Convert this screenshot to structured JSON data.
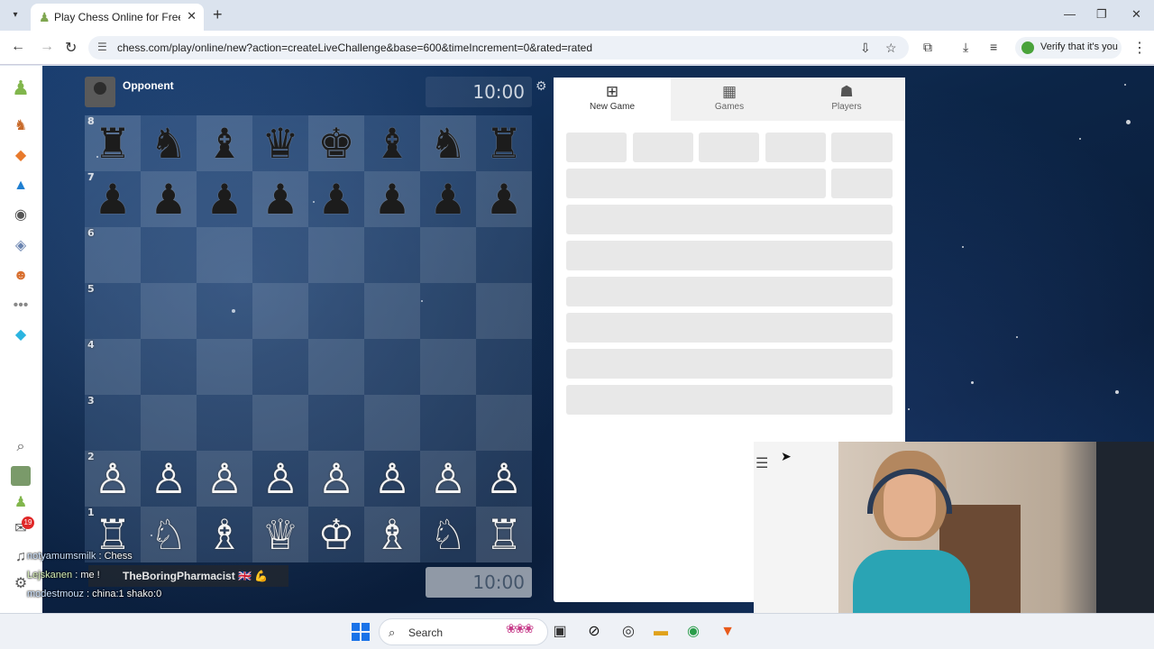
{
  "browser": {
    "tab_title": "Play Chess Online for Free with",
    "url": "chess.com/play/online/new?action=createLiveChallenge&base=600&timeIncrement=0&rated=rated",
    "verify_label": "Verify that it's you"
  },
  "game": {
    "opponent_name": "Opponent",
    "top_clock": "10:00",
    "bottom_clock": "10:00",
    "rank_labels": [
      "8",
      "7",
      "6",
      "5",
      "4",
      "3",
      "2",
      "1"
    ]
  },
  "board": [
    [
      "♜",
      "♞",
      "♝",
      "♛",
      "♚",
      "♝",
      "♞",
      "♜"
    ],
    [
      "♟",
      "♟",
      "♟",
      "♟",
      "♟",
      "♟",
      "♟",
      "♟"
    ],
    [
      "",
      "",
      "",
      "",
      "",
      "",
      "",
      ""
    ],
    [
      "",
      "",
      "",
      "",
      "",
      "",
      "",
      ""
    ],
    [
      "",
      "",
      "",
      "",
      "",
      "",
      "",
      ""
    ],
    [
      "",
      "",
      "",
      "",
      "",
      "",
      "",
      ""
    ],
    [
      "♙",
      "♙",
      "♙",
      "♙",
      "♙",
      "♙",
      "♙",
      "♙"
    ],
    [
      "♖",
      "♘",
      "♗",
      "♕",
      "♔",
      "♗",
      "♘",
      "♖"
    ]
  ],
  "panel": {
    "tabs": [
      {
        "label": "New Game",
        "icon": "plus-square-icon"
      },
      {
        "label": "Games",
        "icon": "board-icon"
      },
      {
        "label": "Players",
        "icon": "players-icon"
      }
    ]
  },
  "sidebar": {
    "notification_count": "19"
  },
  "stream_overlay": {
    "chat": [
      {
        "user": "notyamumsmilk",
        "message": "Chess"
      },
      {
        "user": "Lejskanen",
        "message": "me !"
      },
      {
        "user": "modestmouz",
        "message": "china:1 shako:0"
      }
    ],
    "streamer_name": "TheBoringPharmacist 🇬🇧 💪"
  },
  "taskbar": {
    "search_label": "Search"
  }
}
